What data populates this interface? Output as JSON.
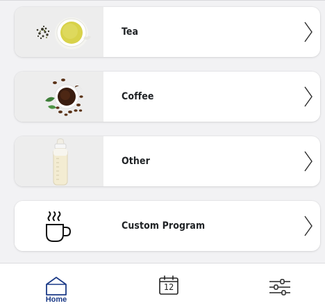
{
  "categories": [
    {
      "label": "Tea",
      "icon": "tea-cup-icon"
    },
    {
      "label": "Coffee",
      "icon": "coffee-cup-icon"
    },
    {
      "label": "Other",
      "icon": "baby-bottle-icon"
    },
    {
      "label": "Custom Program",
      "icon": "steaming-cup-icon"
    }
  ],
  "nav": {
    "home_label": "Home",
    "calendar_day": "12",
    "home_icon": "home-icon",
    "calendar_icon": "calendar-icon",
    "settings_icon": "sliders-icon",
    "active_color": "#1b3a87"
  }
}
